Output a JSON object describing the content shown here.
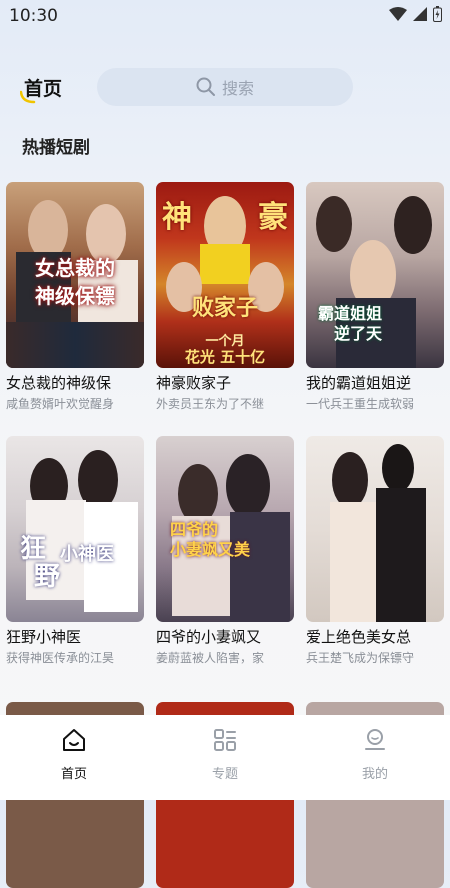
{
  "status_bar": {
    "time": "10:30"
  },
  "header": {
    "home_tab": "首页",
    "search_placeholder": "搜索"
  },
  "section_title": "热播短剧",
  "dramas": [
    {
      "title": "女总裁的神级保",
      "subtitle": "咸鱼赘婿叶欢觉醒身",
      "poster_text": "女总裁的 神级保镖"
    },
    {
      "title": "神豪败家子",
      "subtitle": "外卖员王东为了不继",
      "poster_text": "神 豪 败家子"
    },
    {
      "title": "我的霸道姐姐逆",
      "subtitle": "一代兵王重生成软弱",
      "poster_text": "霸道姐姐 逆了天"
    },
    {
      "title": "狂野小神医",
      "subtitle": "获得神医传承的江昊",
      "poster_text": "狂野小神医"
    },
    {
      "title": "四爷的小妻飒又",
      "subtitle": "姜蔚蓝被人陷害，家",
      "poster_text": "四爷的 小妻飒又美"
    },
    {
      "title": "爱上绝色美女总",
      "subtitle": "兵王楚飞成为保镖守",
      "poster_text": ""
    }
  ],
  "bottom_nav": [
    {
      "label": "首页",
      "icon": "home-icon",
      "active": true
    },
    {
      "label": "专题",
      "icon": "grid-icon",
      "active": false
    },
    {
      "label": "我的",
      "icon": "user-icon",
      "active": false
    }
  ],
  "colors": {
    "accent": "#111111",
    "inactive": "#9aa0a8",
    "search_bg": "#dbe4f1"
  }
}
